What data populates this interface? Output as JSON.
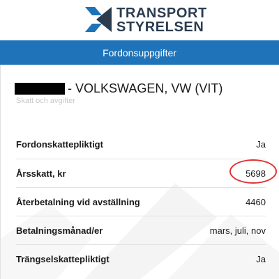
{
  "brand": {
    "name_line1": "TRANSPORT",
    "name_line2": "STYRELSEN",
    "color_text": "#2b3c50",
    "color_mark": "#1f73b8"
  },
  "header": {
    "title": "Fordonsuppgifter",
    "bar_color": "#1f73b8"
  },
  "vehicle": {
    "title": "- VOLKSWAGEN, VW (VIT)",
    "subtitle": "Skatt och avgifter"
  },
  "rows": [
    {
      "label": "Fordonskattepliktigt",
      "value": "Ja"
    },
    {
      "label": "Årsskatt, kr",
      "value": "5698"
    },
    {
      "label": "Återbetalning vid avställning",
      "value": "4460"
    },
    {
      "label": "Betalningsmånad/er",
      "value": "mars, juli, nov"
    },
    {
      "label": "Trängselskattepliktigt",
      "value": "Ja"
    }
  ],
  "annotation": {
    "circle_color": "#e03232",
    "circled_row": "Årsskatt, kr"
  }
}
